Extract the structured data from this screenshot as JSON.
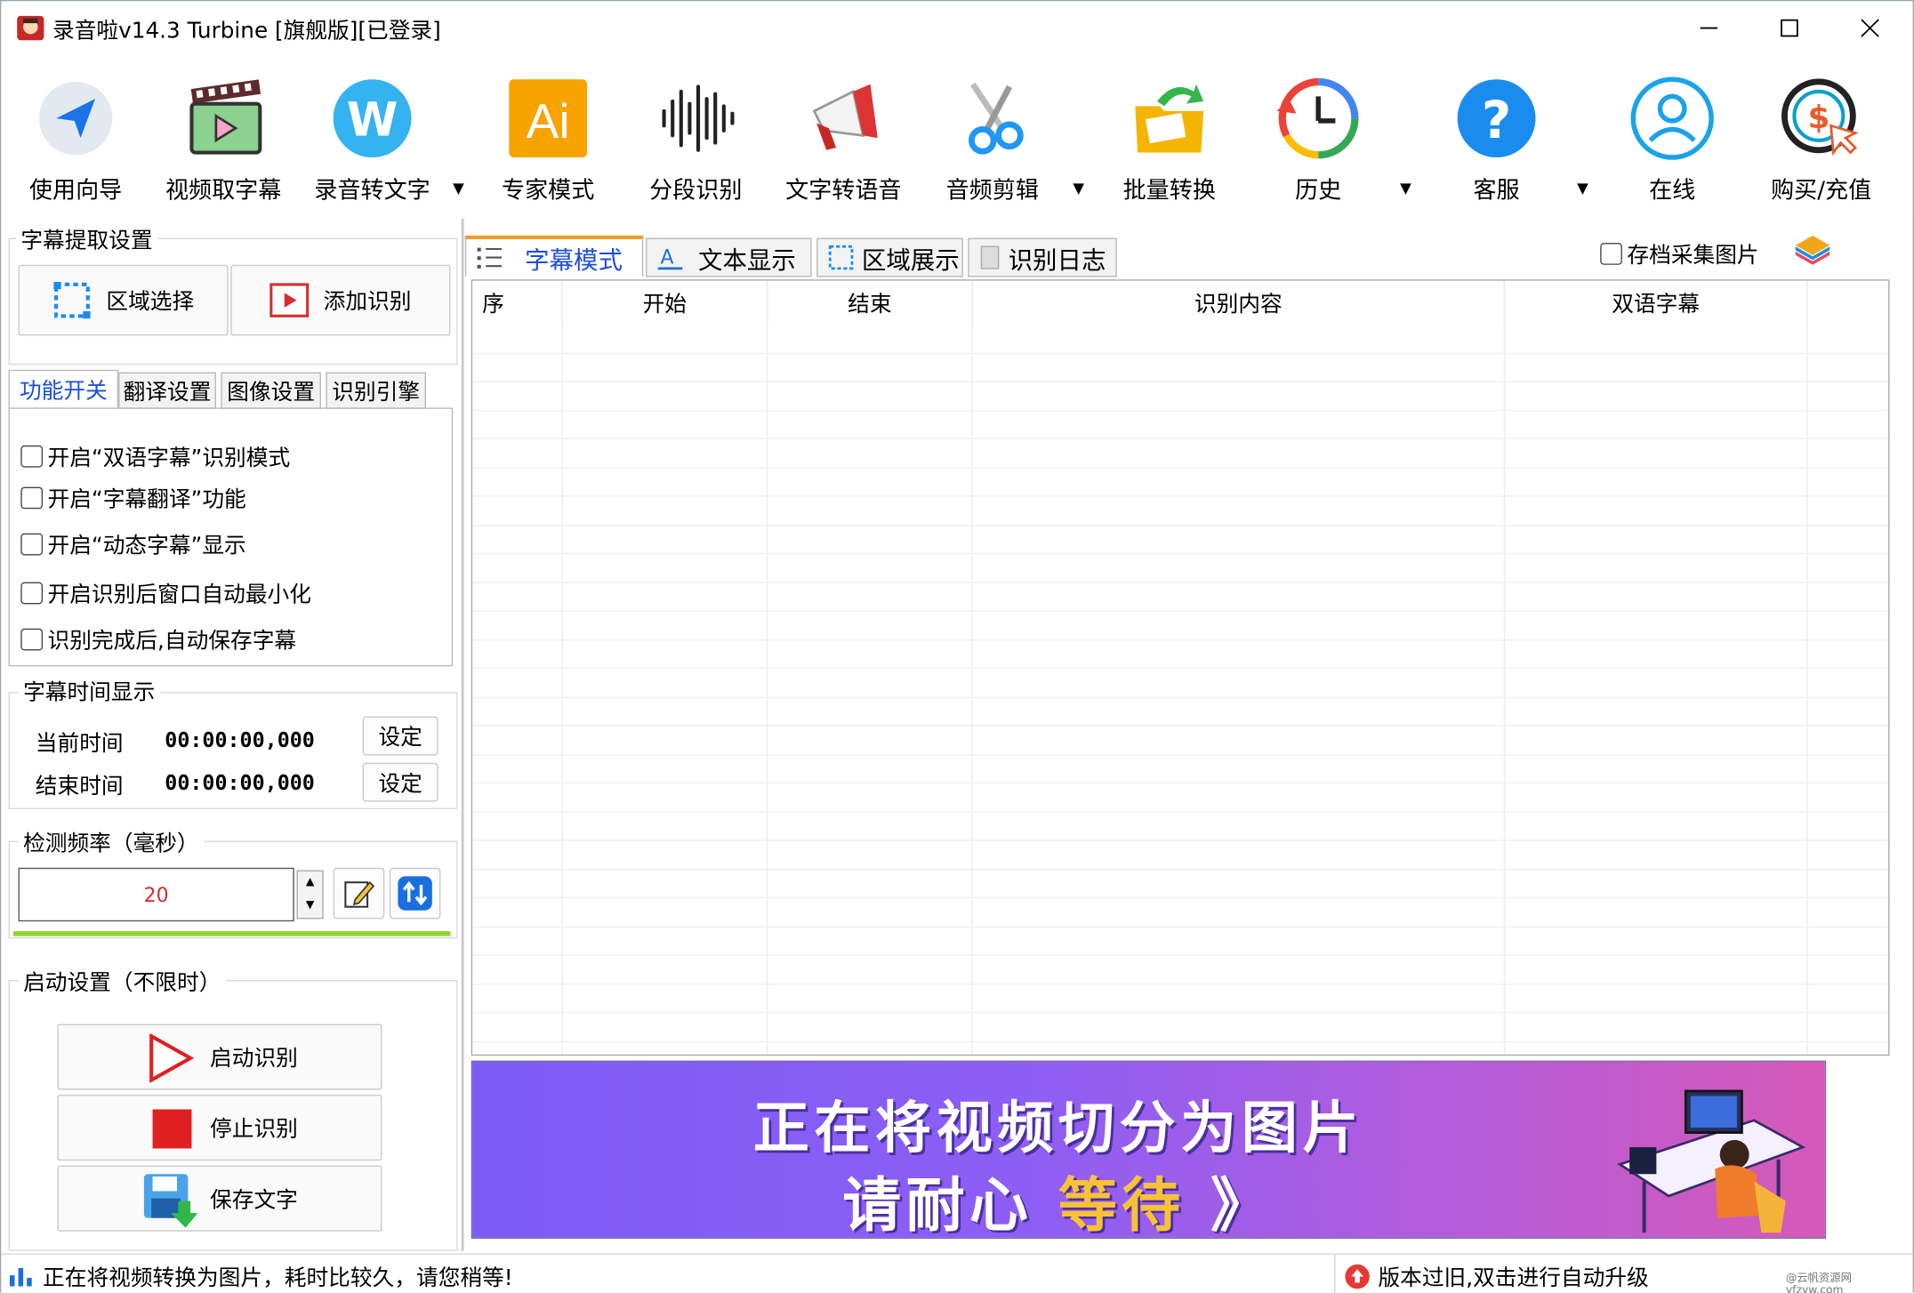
{
  "window": {
    "title": "录音啦v14.3 Turbine [旗舰版][已登录]",
    "minimize": "—",
    "maximize": "☐",
    "close": "✕"
  },
  "toolbar": {
    "items": [
      {
        "label": "使用向导",
        "icon": "navigation-arrow-icon"
      },
      {
        "label": "视频取字幕",
        "icon": "film-play-icon"
      },
      {
        "label": "录音转文字",
        "icon": "w-logo-icon"
      },
      {
        "label": "专家模式",
        "icon": "ai-icon"
      },
      {
        "label": "分段识别",
        "icon": "waveform-icon"
      },
      {
        "label": "文字转语音",
        "icon": "megaphone-icon"
      },
      {
        "label": "音频剪辑",
        "icon": "scissors-icon"
      },
      {
        "label": "批量转换",
        "icon": "folder-arrow-icon"
      },
      {
        "label": "历史",
        "icon": "history-clock-icon"
      },
      {
        "label": "客服",
        "icon": "question-icon"
      },
      {
        "label": "在线",
        "icon": "user-circle-icon"
      },
      {
        "label": "购买/充值",
        "icon": "dollar-coin-icon"
      }
    ]
  },
  "left": {
    "extract_group": "字幕提取设置",
    "region_select": "区域选择",
    "add_recognize": "添加识别",
    "tabs": [
      "功能开关",
      "翻译设置",
      "图像设置",
      "识别引擎"
    ],
    "options": [
      "开启“双语字幕”识别模式",
      "开启“字幕翻译”功能",
      "开启“动态字幕”显示",
      "开启识别后窗口自动最小化",
      "识别完成后,自动保存字幕"
    ],
    "time_group": "字幕时间显示",
    "current_time_label": "当前时间",
    "current_time_value": "00:00:00,000",
    "end_time_label": "结束时间",
    "end_time_value": "00:00:00,000",
    "set_label": "设定",
    "freq_group": "检测频率（毫秒）",
    "freq_value": "20",
    "start_group": "启动设置（不限时）",
    "start_btn": "启动识别",
    "stop_btn": "停止识别",
    "save_btn": "保存文字"
  },
  "right": {
    "tabs": [
      "字幕模式",
      "文本显示",
      "区域展示",
      "识别日志"
    ],
    "save_images_label": "存档采集图片",
    "columns": [
      "序",
      "开始",
      "结束",
      "识别内容",
      "双语字幕"
    ],
    "banner_line1": "正在将视频切分为图片",
    "banner_line2_a": "请耐心",
    "banner_line2_b": "等待",
    "banner_arrows": "》"
  },
  "status": {
    "left_text": "正在将视频转换为图片，耗时比较久，请您稍等!",
    "right_text": "版本过旧,双击进行自动升级",
    "watermark": "@云帆资源网 yfzyw.com"
  },
  "colors": {
    "accent_blue": "#1c4ed8",
    "tab_orange": "#f39a2b",
    "freq_text": "#d32f2f",
    "stop_red": "#e02020"
  }
}
